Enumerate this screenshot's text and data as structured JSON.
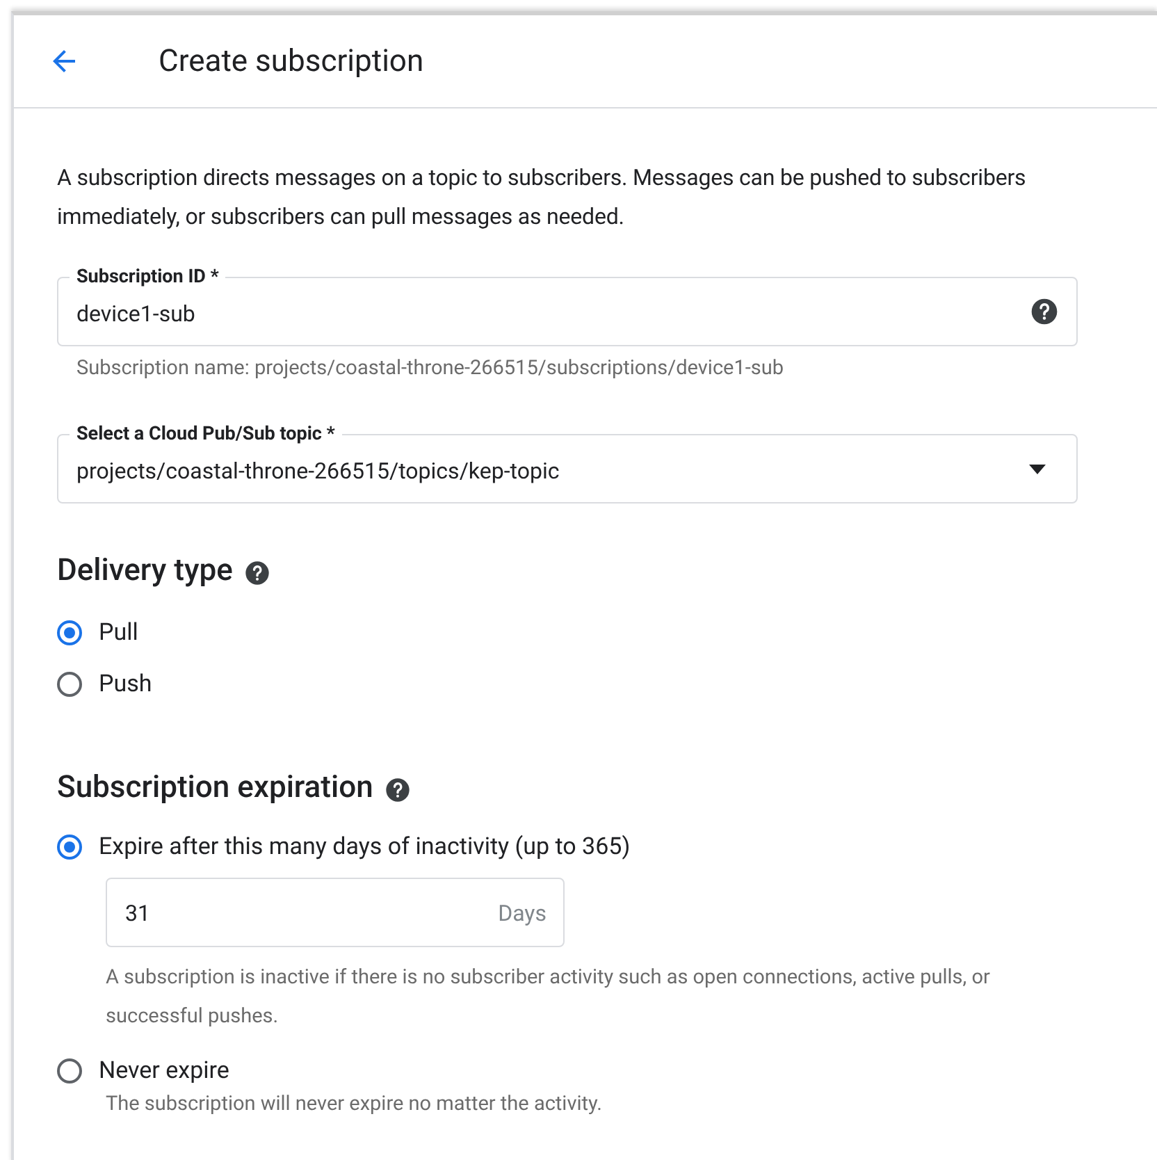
{
  "header": {
    "title": "Create subscription"
  },
  "intro": "A subscription directs messages on a topic to subscribers. Messages can be pushed to subscribers immediately, or subscribers can pull messages as needed.",
  "subscription_id": {
    "label": "Subscription ID *",
    "value": "device1-sub",
    "helper": "Subscription name: projects/coastal-throne-266515/subscriptions/device1-sub"
  },
  "topic": {
    "label": "Select a Cloud Pub/Sub topic *",
    "value": "projects/coastal-throne-266515/topics/kep-topic"
  },
  "delivery_type": {
    "title": "Delivery type",
    "options": [
      {
        "label": "Pull",
        "selected": true
      },
      {
        "label": "Push",
        "selected": false
      }
    ]
  },
  "expiration": {
    "title": "Subscription expiration",
    "options": [
      {
        "label": "Expire after this many days of inactivity (up to 365)",
        "selected": true,
        "field": {
          "value": "31",
          "suffix": "Days"
        },
        "helper": "A subscription is inactive if there is no subscriber activity such as open connections, active pulls, or successful pushes."
      },
      {
        "label": "Never expire",
        "selected": false,
        "helper": "The subscription will never expire no matter the activity."
      }
    ]
  }
}
